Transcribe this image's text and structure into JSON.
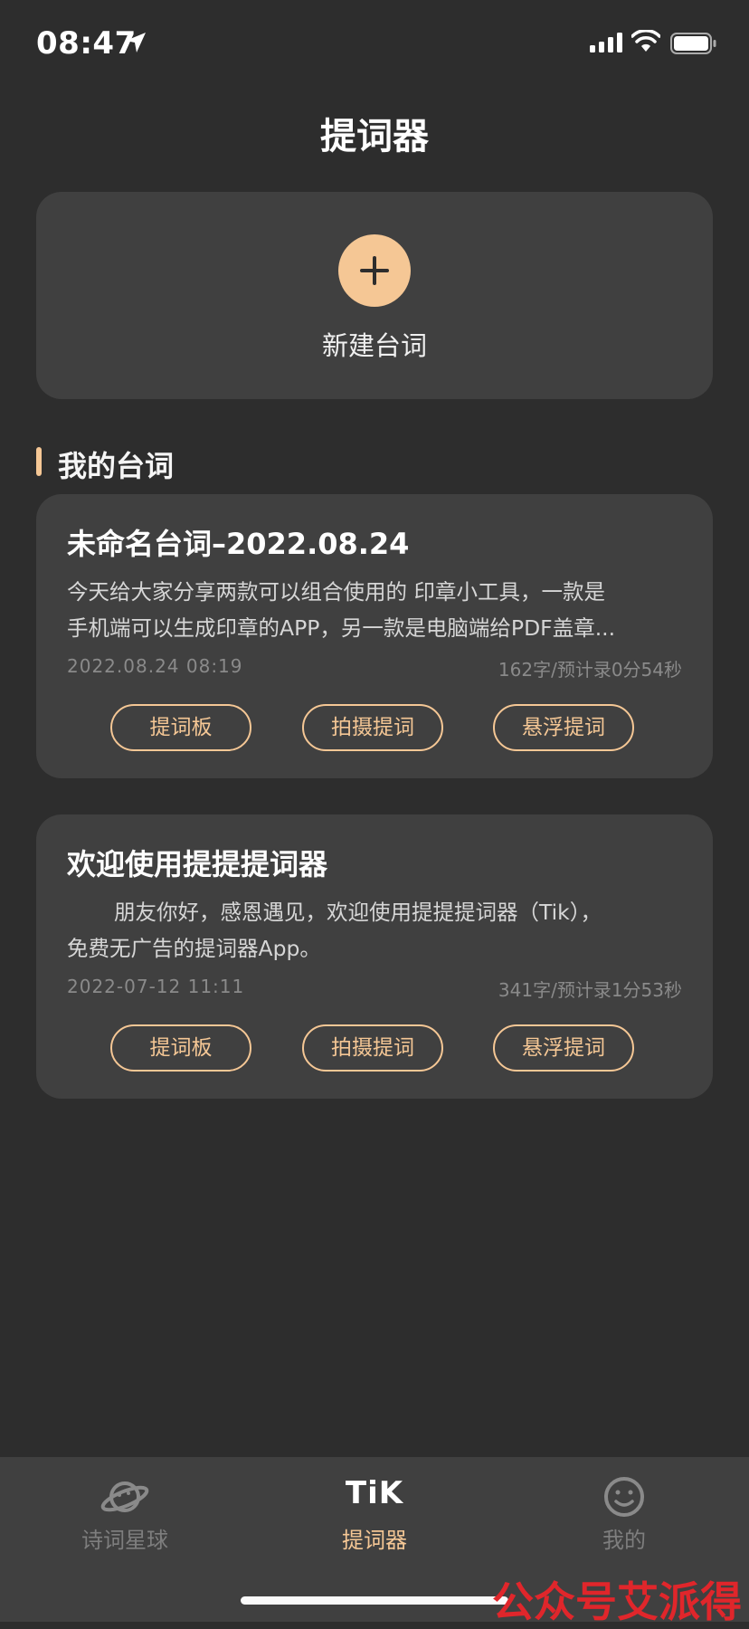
{
  "status_bar": {
    "time": "08:47"
  },
  "header": {
    "title": "提词器"
  },
  "new_script": {
    "label": "新建台词"
  },
  "section": {
    "title": "我的台词"
  },
  "scripts": [
    {
      "title": "未命名台词–2022.08.24",
      "excerpt_line1": "今天给大家分享两款可以组合使用的 印章小工具，一款是",
      "excerpt_line2": "手机端可以生成印章的APP，另一款是电脑端给PDF盖章...",
      "date": "2022.08.24 08:19",
      "stats": "162字/预计录0分54秒",
      "btn_board": "提词板",
      "btn_camera": "拍摄提词",
      "btn_float": "悬浮提词"
    },
    {
      "title": "欢迎使用提提提词器",
      "excerpt_line1": "朋友你好，感恩遇见，欢迎使用提提提词器（Tik），",
      "excerpt_line2": "免费无广告的提词器App。",
      "date": "2022-07-12 11:11",
      "stats": "341字/预计录1分53秒",
      "btn_board": "提词板",
      "btn_camera": "拍摄提词",
      "btn_float": "悬浮提词"
    }
  ],
  "tabs": [
    {
      "label": "诗词星球",
      "icon": "planet-icon",
      "active": false
    },
    {
      "label": "提词器",
      "icon": "tik-logo",
      "logo_text": "TiK",
      "active": true
    },
    {
      "label": "我的",
      "icon": "smiley-icon",
      "active": false
    }
  ],
  "watermark": "公众号艾派得",
  "colors": {
    "accent": "#f5c795",
    "background": "#2d2d2d",
    "card": "#404040",
    "watermark": "#e0262b"
  }
}
